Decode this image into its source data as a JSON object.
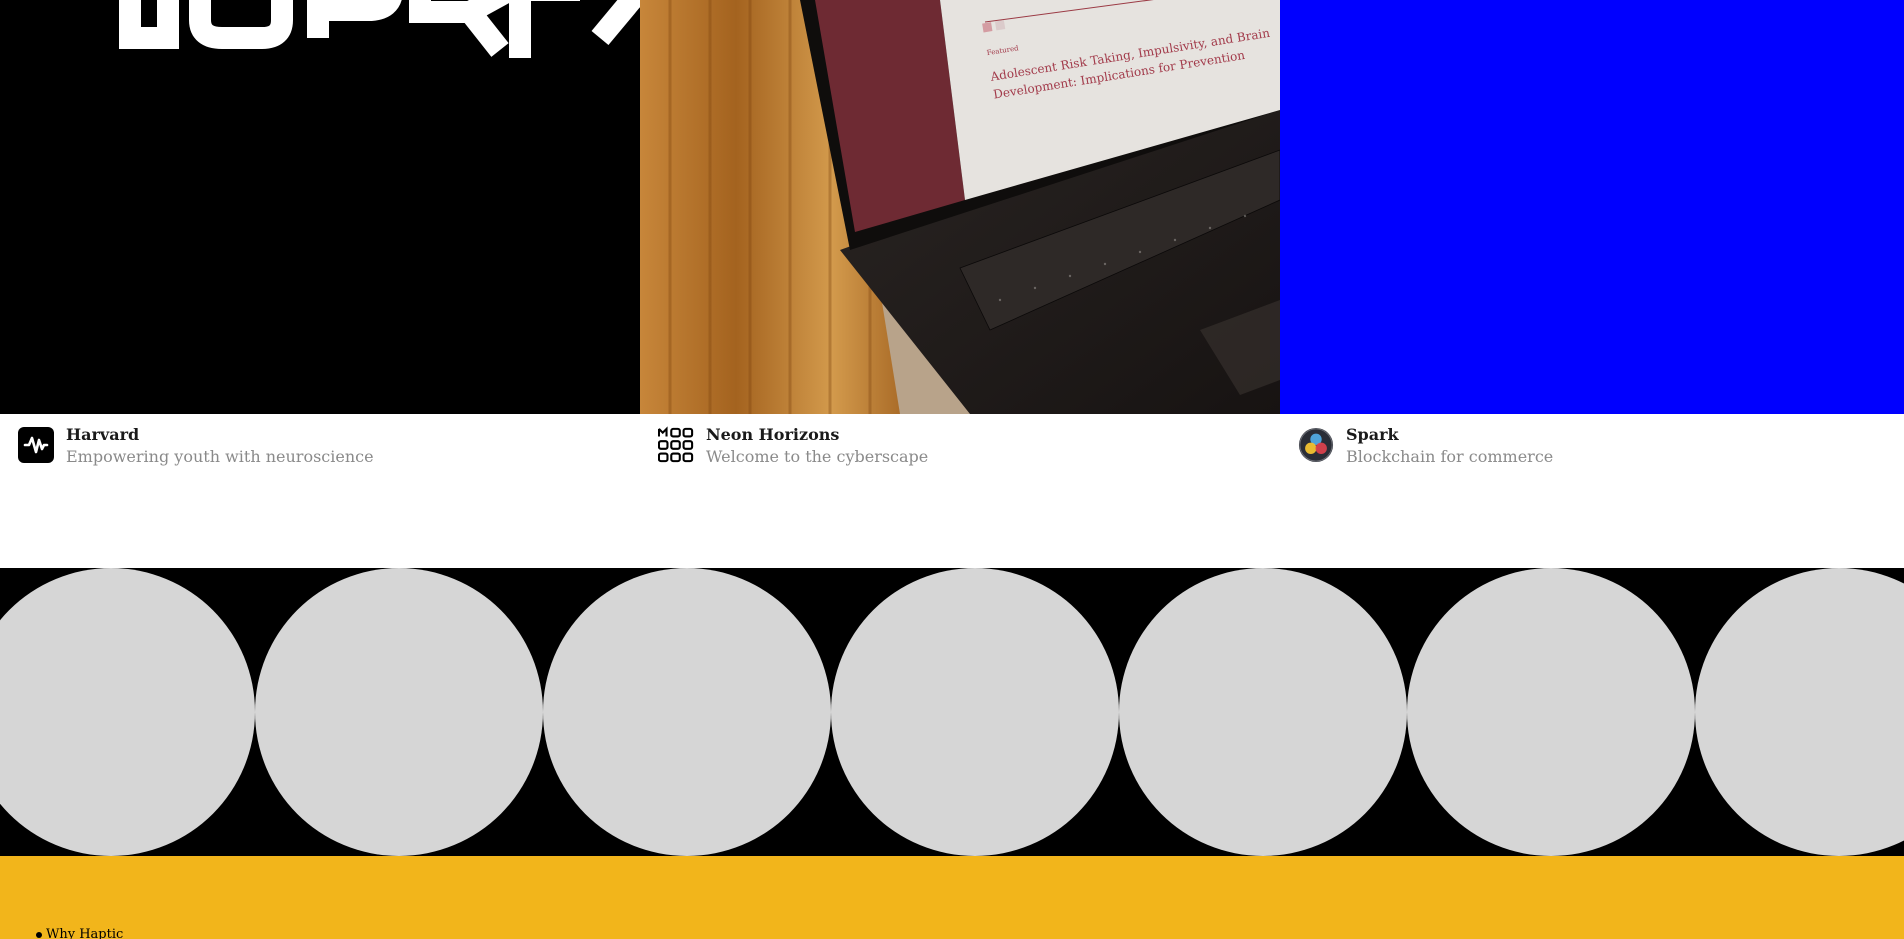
{
  "colors": {
    "card1_bg": "#000000",
    "card3_bg": "#0000ff",
    "circles_band_bg": "#000000",
    "circle_fill": "#d6d6d6",
    "footer_bg": "#f2b51b",
    "title_text": "#1a1a1a",
    "subtitle_text": "#8a8a8a"
  },
  "cards": [
    {
      "title": "Harvard",
      "subtitle": "Empowering youth with neuroscience",
      "logo_icon": "waveform-icon"
    },
    {
      "title": "Neon Horizons",
      "subtitle": "Welcome to the cyberscape",
      "logo_icon": "grid-dots-icon",
      "photo": {
        "featured_label": "Featured",
        "article_title_line1": "Adolescent Risk Taking, Impulsivity, and Brain",
        "article_title_line2": "Development: Implications for Prevention"
      }
    },
    {
      "title": "Spark",
      "subtitle": "Blockchain for commerce",
      "logo_icon": "tri-color-circle-icon"
    }
  ],
  "circles_count": 7,
  "footer": {
    "items": [
      "Why Haptic"
    ]
  }
}
